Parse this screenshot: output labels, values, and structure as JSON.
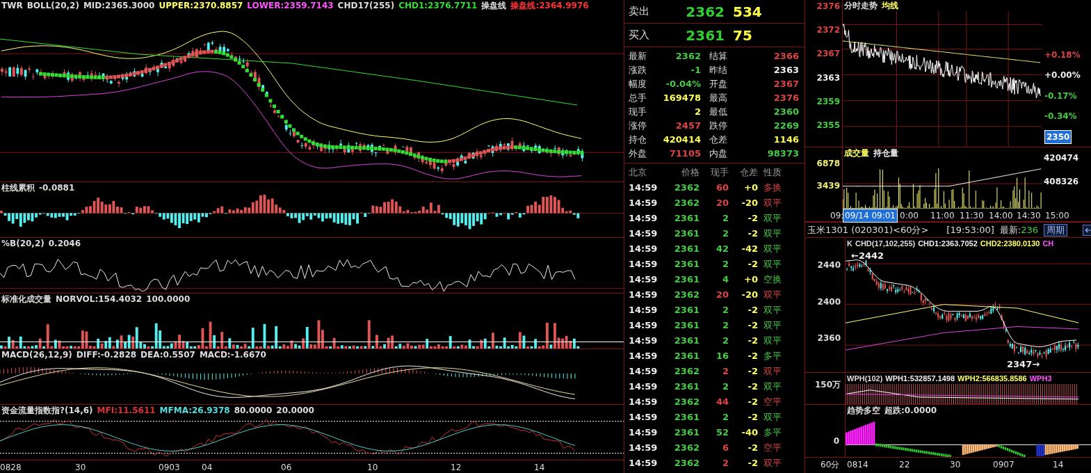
{
  "main_chart": {
    "legend": [
      {
        "text": "TWR",
        "color": "#dddddd"
      },
      {
        "text": "BOLL(20,2)",
        "color": "#dddddd"
      },
      {
        "text": "MID:2365.3000",
        "color": "#dddddd"
      },
      {
        "text": "UPPER:2370.8857",
        "color": "#ffff66"
      },
      {
        "text": "LOWER:2359.7143",
        "color": "#ff55ff"
      },
      {
        "text": "CHD17(255)",
        "color": "#dddddd"
      },
      {
        "text": "CHD1:2376.7711",
        "color": "#33dd33"
      },
      {
        "text": "操盘线",
        "color": "#dddddd"
      },
      {
        "text": "操盘线:2364.9976",
        "color": "#ff3333"
      }
    ]
  },
  "subcharts": [
    {
      "kind": "histogram",
      "legend": [
        {
          "text": "柱线累积",
          "color": "#dddddd"
        },
        {
          "text": "-0.0881",
          "color": "#dddddd"
        }
      ]
    },
    {
      "kind": "line",
      "legend": [
        {
          "text": "%B(20,2)",
          "color": "#dddddd"
        },
        {
          "text": "0.2046",
          "color": "#dddddd"
        }
      ]
    },
    {
      "kind": "volume",
      "legend": [
        {
          "text": "标准化成交量",
          "color": "#dddddd"
        },
        {
          "text": "NORVOL:154.4032",
          "color": "#dddddd"
        },
        {
          "text": "100.0000",
          "color": "#dddddd"
        }
      ]
    },
    {
      "kind": "macd",
      "legend": [
        {
          "text": "MACD(26,12,9)",
          "color": "#dddddd"
        },
        {
          "text": "DIFF:-0.2828",
          "color": "#dddddd"
        },
        {
          "text": "DEA:0.5507",
          "color": "#dddddd"
        },
        {
          "text": "MACD:-1.6670",
          "color": "#dddddd"
        }
      ]
    },
    {
      "kind": "flow",
      "legend": [
        {
          "text": "资金流量指数指?(14,6)",
          "color": "#dddddd"
        },
        {
          "text": "MFI:11.5611",
          "color": "#dd3333"
        },
        {
          "text": "MFMA:26.9378",
          "color": "#55dddd"
        },
        {
          "text": "80.0000",
          "color": "#dddddd"
        },
        {
          "text": "20.0000",
          "color": "#dddddd"
        }
      ]
    }
  ],
  "date_axis": [
    "0828",
    "30",
    "0903",
    "04",
    "06",
    "10",
    "12",
    "14"
  ],
  "orders": [
    {
      "label": "卖出",
      "price": "2362",
      "volume": "534"
    },
    {
      "label": "买入",
      "price": "2361",
      "volume": "75"
    }
  ],
  "stats": [
    {
      "label": "最新",
      "value": "2362",
      "color": "#44cc44"
    },
    {
      "label": "结算",
      "value": "2366",
      "color": "#dd4444"
    },
    {
      "label": "涨跌",
      "value": "-1",
      "color": "#44cc44"
    },
    {
      "label": "昨结",
      "value": "2363",
      "color": "#eeeeee"
    },
    {
      "label": "幅度",
      "value": "-0.04%",
      "color": "#44cc44"
    },
    {
      "label": "开盘",
      "value": "2367",
      "color": "#dd4444"
    },
    {
      "label": "总手",
      "value": "169478",
      "color": "#ffff55"
    },
    {
      "label": "最高",
      "value": "2376",
      "color": "#dd4444"
    },
    {
      "label": "现手",
      "value": "2",
      "color": "#ffff55"
    },
    {
      "label": "最低",
      "value": "2360",
      "color": "#44cc44"
    },
    {
      "label": "涨停",
      "value": "2457",
      "color": "#dd4444"
    },
    {
      "label": "跌停",
      "value": "2269",
      "color": "#44cc44"
    },
    {
      "label": "持仓",
      "value": "420414",
      "color": "#ffff55"
    },
    {
      "label": "仓差",
      "value": "1146",
      "color": "#ffff55"
    },
    {
      "label": "外盘",
      "value": "71105",
      "color": "#dd4444"
    },
    {
      "label": "内盘",
      "value": "98373",
      "color": "#44cc44"
    }
  ],
  "trades": {
    "columns": [
      "北京",
      "价格",
      "现手",
      "仓差",
      "性质"
    ],
    "rows": [
      {
        "time": "14:59",
        "price": "2362",
        "volume": "60",
        "change": "+0",
        "nature": "多换",
        "up": true
      },
      {
        "time": "14:59",
        "price": "2362",
        "volume": "20",
        "change": "-20",
        "nature": "双平",
        "up": true
      },
      {
        "time": "14:59",
        "price": "2361",
        "volume": "2",
        "change": "-2",
        "nature": "双平",
        "up": false
      },
      {
        "time": "14:59",
        "price": "2361",
        "volume": "2",
        "change": "-2",
        "nature": "双平",
        "up": false
      },
      {
        "time": "14:59",
        "price": "2361",
        "volume": "42",
        "change": "-42",
        "nature": "双平",
        "up": false
      },
      {
        "time": "14:59",
        "price": "2361",
        "volume": "2",
        "change": "-2",
        "nature": "双平",
        "up": false
      },
      {
        "time": "14:59",
        "price": "2361",
        "volume": "4",
        "change": "+0",
        "nature": "空换",
        "up": false
      },
      {
        "time": "14:59",
        "price": "2362",
        "volume": "20",
        "change": "-20",
        "nature": "双平",
        "up": true
      },
      {
        "time": "14:59",
        "price": "2361",
        "volume": "2",
        "change": "-2",
        "nature": "双平",
        "up": false
      },
      {
        "time": "14:59",
        "price": "2361",
        "volume": "2",
        "change": "-2",
        "nature": "双平",
        "up": false
      },
      {
        "time": "14:59",
        "price": "2361",
        "volume": "2",
        "change": "-2",
        "nature": "双平",
        "up": false
      },
      {
        "time": "14:59",
        "price": "2361",
        "volume": "16",
        "change": "-2",
        "nature": "多平",
        "up": false
      },
      {
        "time": "14:59",
        "price": "2362",
        "volume": "2",
        "change": "-2",
        "nature": "双平",
        "up": true
      },
      {
        "time": "14:59",
        "price": "2361",
        "volume": "2",
        "change": "-2",
        "nature": "双平",
        "up": false
      },
      {
        "time": "14:59",
        "price": "2362",
        "volume": "44",
        "change": "-2",
        "nature": "空平",
        "up": true
      },
      {
        "time": "14:59",
        "price": "2361",
        "volume": "2",
        "change": "-2",
        "nature": "双平",
        "up": false
      },
      {
        "time": "14:59",
        "price": "2361",
        "volume": "52",
        "change": "-40",
        "nature": "多平",
        "up": false
      },
      {
        "time": "14:59",
        "price": "2362",
        "volume": "6",
        "change": "-2",
        "nature": "空平",
        "up": true
      },
      {
        "time": "14:59",
        "price": "2362",
        "volume": "2",
        "change": "-2",
        "nature": "双平",
        "up": true
      }
    ]
  },
  "intraday": {
    "legend": [
      {
        "text": "分时走势",
        "color": "#dddddd"
      },
      {
        "text": "均线",
        "color": "#ffff66"
      }
    ],
    "price_labels": [
      {
        "text": "2376",
        "color": "#dd4444"
      },
      {
        "text": "2372",
        "color": "#dd4444"
      },
      {
        "text": "2367",
        "color": "#dd4444"
      },
      {
        "text": "2363",
        "color": "#eeeeee"
      },
      {
        "text": "2359",
        "color": "#44cc44"
      },
      {
        "text": "2355",
        "color": "#44cc44"
      }
    ],
    "percent_labels": [
      {
        "text": "+0.18%",
        "color": "#dd4444"
      },
      {
        "text": "+0.00%",
        "color": "#eeeeee"
      },
      {
        "text": "-0.17%",
        "color": "#44cc44"
      },
      {
        "text": "-0.34%",
        "color": "#44cc44"
      }
    ],
    "cursor_price": "2350",
    "volume_legend": [
      {
        "text": "成交量",
        "color": "#ffff66"
      },
      {
        "text": "持仓量",
        "color": "#eeeeee"
      }
    ],
    "volume_labels": [
      "6878",
      "3439"
    ],
    "hold_labels": [
      "420474",
      "408326"
    ],
    "time_axis": [
      {
        "text": "09:",
        "selected": false
      },
      {
        "text": "09/14 09:01",
        "selected": true
      },
      {
        "text": "0:00",
        "selected": false
      },
      {
        "text": "11:00",
        "selected": false
      },
      {
        "text": "11:30",
        "selected": false
      },
      {
        "text": "14:00",
        "selected": false
      },
      {
        "text": "14:30",
        "selected": false
      },
      {
        "text": "15:00",
        "selected": false
      }
    ]
  },
  "kline": {
    "header": {
      "title": "玉米1301 (020301)<60分>",
      "time": "[19:53:00]",
      "latest_label": "最新:",
      "latest_value": "236",
      "period_button": "周期"
    },
    "legend": [
      {
        "text": "K",
        "color": "#dddddd"
      },
      {
        "text": "CHD(17,102,255)",
        "color": "#dddddd"
      },
      {
        "text": "CHD1:2363.7052",
        "color": "#eeeeee"
      },
      {
        "text": "CHD2:2380.0130",
        "color": "#ffff66"
      },
      {
        "text": "CH",
        "color": "#ff55ff"
      }
    ],
    "price_labels": [
      "2440",
      "2400",
      "2360"
    ],
    "high_marker": "←2442",
    "low_marker": "2347→",
    "wph_legend": [
      {
        "text": "WPH(102)",
        "color": "#dddddd"
      },
      {
        "text": "WPH1:532857.1498",
        "color": "#eeeeee"
      },
      {
        "text": "WPH2:566835.8586",
        "color": "#ffff66"
      },
      {
        "text": "WPH3",
        "color": "#ff55ff"
      }
    ],
    "wph_label": "150万",
    "trend_legend": [
      {
        "text": "趋势多空",
        "color": "#dddddd"
      },
      {
        "text": "超跌:0.0000",
        "color": "#dddddd"
      }
    ],
    "trend_label": "0",
    "axis": [
      "60分",
      "0814",
      "22",
      "30",
      "0907",
      "14"
    ]
  }
}
